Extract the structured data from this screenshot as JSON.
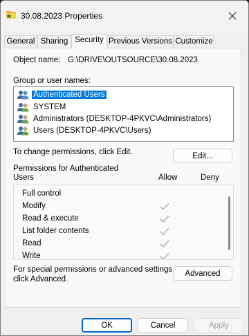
{
  "window": {
    "title": "30.08.2023 Properties",
    "close_glyph": "✕"
  },
  "tabs": [
    {
      "label": "General",
      "active": false
    },
    {
      "label": "Sharing",
      "active": false
    },
    {
      "label": "Security",
      "active": true
    },
    {
      "label": "Previous Versions",
      "active": false
    },
    {
      "label": "Customize",
      "active": false
    }
  ],
  "security": {
    "object_name_label": "Object name:",
    "object_name_value": "G:\\DRIVE\\OUTSOURCE\\30.08.2023",
    "group_label": "Group or user names:",
    "groups": [
      {
        "label": "Authenticated Users",
        "selected": true
      },
      {
        "label": "SYSTEM",
        "selected": false
      },
      {
        "label": "Administrators (DESKTOP-4PKVC\\Administrators)",
        "selected": false
      },
      {
        "label": "Users (DESKTOP-4PKVC\\Users)",
        "selected": false
      }
    ],
    "change_text": "To change permissions, click Edit.",
    "edit_button": "Edit...",
    "permissions_for_line1": "Permissions for Authenticated",
    "permissions_for_line2": "Users",
    "allow_header": "Allow",
    "deny_header": "Deny",
    "permissions": [
      {
        "name": "Full control",
        "allow": false,
        "deny": false
      },
      {
        "name": "Modify",
        "allow": true,
        "deny": false
      },
      {
        "name": "Read & execute",
        "allow": true,
        "deny": false
      },
      {
        "name": "List folder contents",
        "allow": true,
        "deny": false
      },
      {
        "name": "Read",
        "allow": true,
        "deny": false
      },
      {
        "name": "Write",
        "allow": true,
        "deny": false
      }
    ],
    "special_text_line1": "For special permissions or advanced settings,",
    "special_text_line2": "click Advanced.",
    "advanced_button": "Advanced"
  },
  "footer": {
    "ok": "OK",
    "cancel": "Cancel",
    "apply": "Apply"
  },
  "colors": {
    "selection": "#0078d7",
    "check_grey": "#b4b4b4",
    "primary_border": "#0067c0"
  }
}
